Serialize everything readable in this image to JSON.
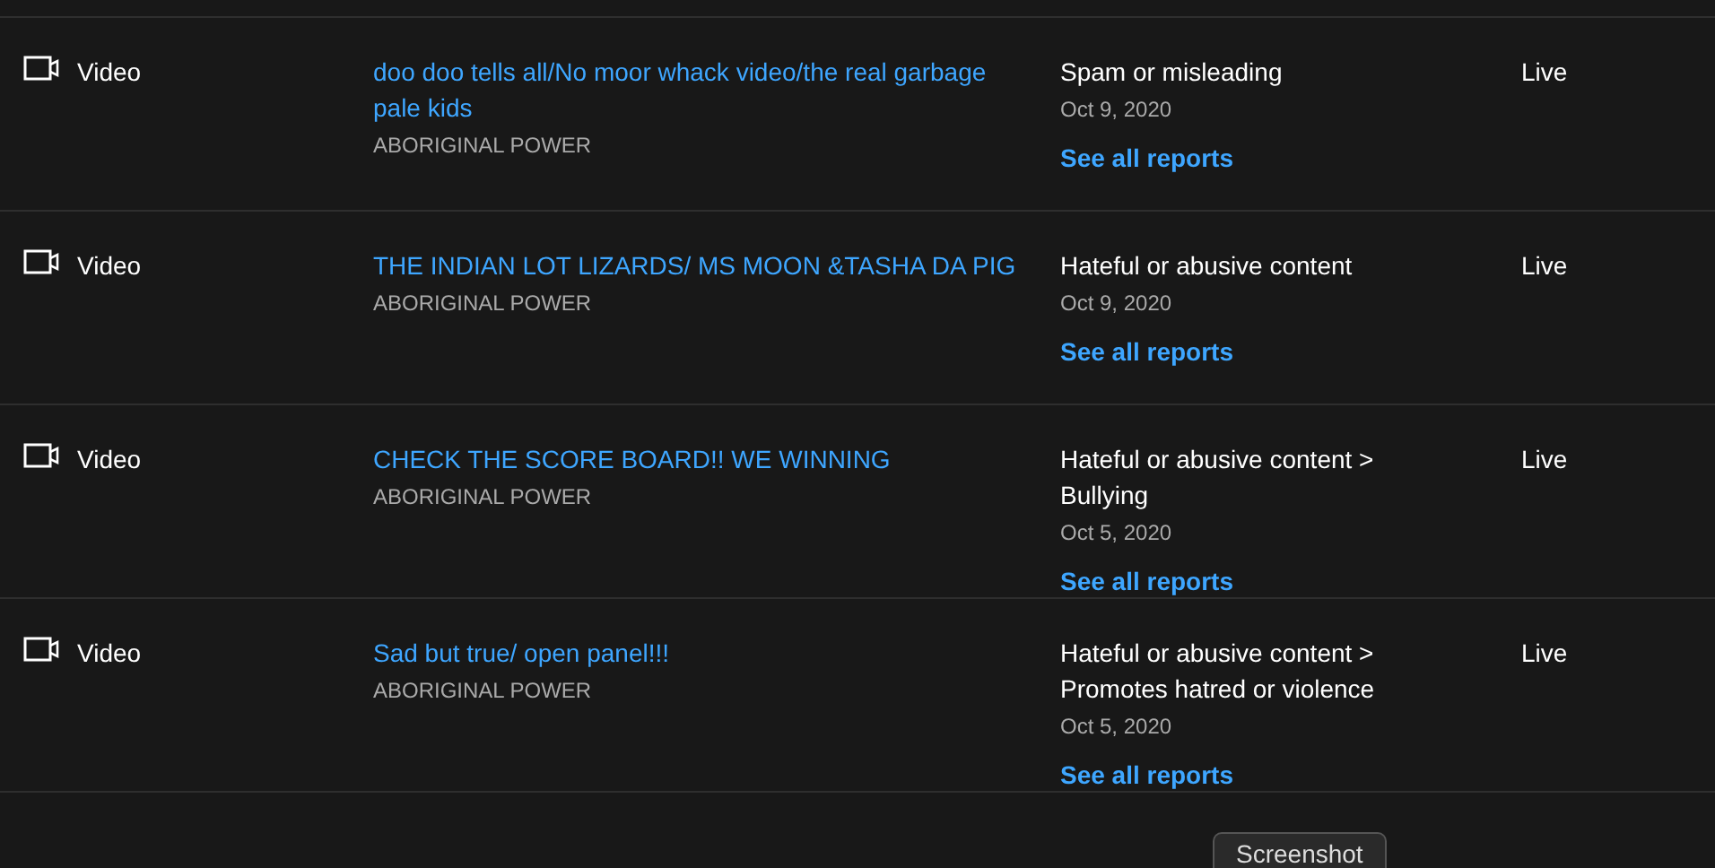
{
  "rows": [
    {
      "type": "Video",
      "title": "doo doo tells all/No moor whack video/the real garbage pale kids",
      "channel": "ABORIGINAL POWER",
      "reason": "Spam or misleading",
      "date": "Oct 9, 2020",
      "link": "See all reports",
      "status": "Live"
    },
    {
      "type": "Video",
      "title": "THE INDIAN LOT LIZARDS/ MS MOON &TASHA DA PIG",
      "channel": "ABORIGINAL POWER",
      "reason": "Hateful or abusive content",
      "date": "Oct 9, 2020",
      "link": "See all reports",
      "status": "Live"
    },
    {
      "type": "Video",
      "title": "CHECK THE SCORE BOARD!! WE WINNING",
      "channel": "ABORIGINAL POWER",
      "reason": "Hateful or abusive content > Bullying",
      "date": "Oct 5, 2020",
      "link": "See all reports",
      "status": "Live"
    },
    {
      "type": "Video",
      "title": "Sad but true/ open panel!!!",
      "channel": "ABORIGINAL POWER",
      "reason": "Hateful or abusive content > Promotes hatred or violence",
      "date": "Oct 5, 2020",
      "link": "See all reports",
      "status": "Live"
    }
  ],
  "tooltip": "Screenshot"
}
